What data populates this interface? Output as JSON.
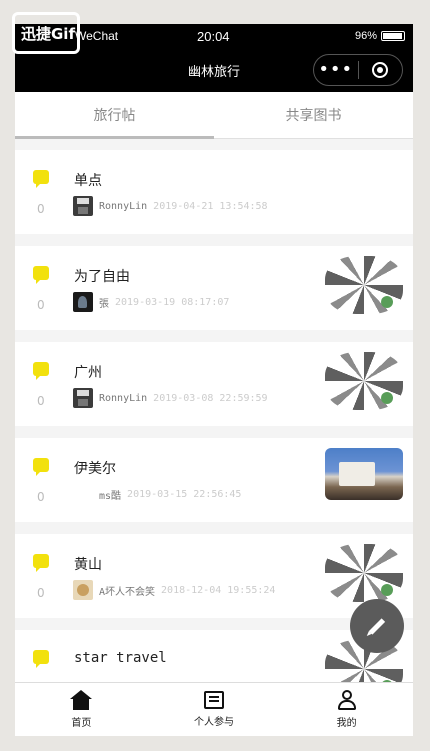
{
  "watermark": {
    "text": "迅捷Gif"
  },
  "status_bar": {
    "carrier": "WeChat",
    "time": "20:04",
    "battery": "96%"
  },
  "navbar": {
    "title": "幽林旅行",
    "menu_glyph": "•••"
  },
  "tabs": [
    {
      "label": "旅行帖",
      "active": true
    },
    {
      "label": "共享图书",
      "active": false
    }
  ],
  "posts": [
    {
      "title": "单点",
      "count": "0",
      "user": "RonnyLin",
      "date": "2019-04-21 13:54:58",
      "avatar": "floppy-disk-avatar",
      "thumb": "none"
    },
    {
      "title": "为了自由",
      "count": "0",
      "user": "張",
      "date": "2019-03-19 08:17:07",
      "avatar": "dark-portrait-avatar",
      "thumb": "qr-code"
    },
    {
      "title": "广州",
      "count": "0",
      "user": "RonnyLin",
      "date": "2019-03-08 22:59:59",
      "avatar": "floppy-disk-avatar",
      "thumb": "qr-code"
    },
    {
      "title": "伊美尔",
      "count": "0",
      "user": "ms酷",
      "date": "2019-03-15 22:56:45",
      "avatar": "blank-avatar",
      "thumb": "photo"
    },
    {
      "title": "黄山",
      "count": "0",
      "user": "A坏人不会笑",
      "date": "2018-12-04 19:55:24",
      "avatar": "cartoon-avatar",
      "thumb": "qr-code"
    },
    {
      "title": "star travel",
      "count": "",
      "user": "",
      "date": "",
      "avatar": "blank-avatar",
      "thumb": "qr-code"
    }
  ],
  "tabbar": [
    {
      "label": "首页",
      "icon": "home-icon"
    },
    {
      "label": "个人参与",
      "icon": "document-icon"
    },
    {
      "label": "我的",
      "icon": "user-icon"
    }
  ],
  "colors": {
    "bubble": "#f2e10d",
    "fab": "#5b5b5b",
    "nav": "#000000"
  }
}
